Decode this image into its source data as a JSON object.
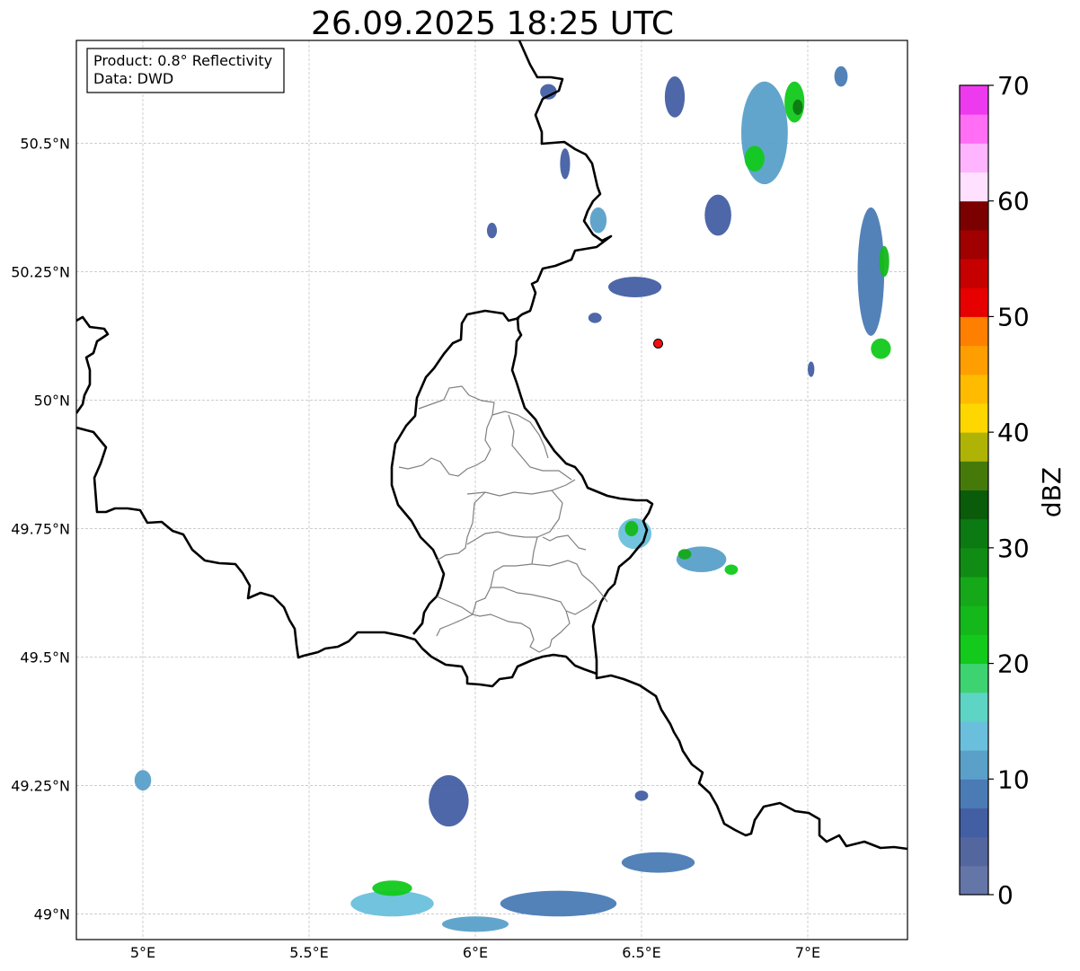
{
  "title": "26.09.2025 18:25 UTC",
  "info_box": {
    "product": "Product: 0.8° Reflectivity",
    "source": "Data: DWD"
  },
  "map": {
    "lon_range": [
      4.8,
      7.3
    ],
    "lat_range": [
      48.95,
      50.7
    ],
    "lat_ticks": [
      {
        "value": 50.5,
        "label": "50.5°N"
      },
      {
        "value": 50.25,
        "label": "50.25°N"
      },
      {
        "value": 50.0,
        "label": "50°N"
      },
      {
        "value": 49.75,
        "label": "49.75°N"
      },
      {
        "value": 49.5,
        "label": "49.5°N"
      },
      {
        "value": 49.25,
        "label": "49.25°N"
      },
      {
        "value": 49.0,
        "label": "49°N"
      }
    ],
    "lon_ticks": [
      {
        "value": 5.0,
        "label": "5°E"
      },
      {
        "value": 5.5,
        "label": "5.5°E"
      },
      {
        "value": 6.0,
        "label": "6°E"
      },
      {
        "value": 6.5,
        "label": "6.5°E"
      },
      {
        "value": 7.0,
        "label": "7°E"
      }
    ],
    "gridlines": true,
    "radar_site": {
      "lon": 6.55,
      "lat": 50.11
    },
    "echoes": [
      {
        "lon": 5.0,
        "lat": 49.26,
        "dbz": 12,
        "w": 0.05,
        "h": 0.04
      },
      {
        "lon": 5.92,
        "lat": 49.22,
        "dbz": 6,
        "w": 0.12,
        "h": 0.1
      },
      {
        "lon": 6.5,
        "lat": 49.23,
        "dbz": 5,
        "w": 0.04,
        "h": 0.02
      },
      {
        "lon": 5.75,
        "lat": 49.02,
        "dbz": 14,
        "w": 0.25,
        "h": 0.05
      },
      {
        "lon": 5.75,
        "lat": 49.05,
        "dbz": 22,
        "w": 0.12,
        "h": 0.03
      },
      {
        "lon": 6.25,
        "lat": 49.02,
        "dbz": 9,
        "w": 0.35,
        "h": 0.05
      },
      {
        "lon": 6.55,
        "lat": 49.1,
        "dbz": 8,
        "w": 0.22,
        "h": 0.04
      },
      {
        "lon": 6.0,
        "lat": 48.98,
        "dbz": 12,
        "w": 0.2,
        "h": 0.03
      },
      {
        "lon": 6.48,
        "lat": 49.74,
        "dbz": 14,
        "w": 0.1,
        "h": 0.06
      },
      {
        "lon": 6.47,
        "lat": 49.75,
        "dbz": 24,
        "w": 0.04,
        "h": 0.03
      },
      {
        "lon": 6.68,
        "lat": 49.69,
        "dbz": 12,
        "w": 0.15,
        "h": 0.05
      },
      {
        "lon": 6.63,
        "lat": 49.7,
        "dbz": 26,
        "w": 0.04,
        "h": 0.02
      },
      {
        "lon": 6.77,
        "lat": 49.67,
        "dbz": 22,
        "w": 0.04,
        "h": 0.02
      },
      {
        "lon": 6.6,
        "lat": 50.59,
        "dbz": 7,
        "w": 0.06,
        "h": 0.08
      },
      {
        "lon": 6.73,
        "lat": 50.36,
        "dbz": 6,
        "w": 0.08,
        "h": 0.08
      },
      {
        "lon": 6.87,
        "lat": 50.52,
        "dbz": 10,
        "w": 0.14,
        "h": 0.2
      },
      {
        "lon": 6.84,
        "lat": 50.47,
        "dbz": 22,
        "w": 0.06,
        "h": 0.05
      },
      {
        "lon": 6.96,
        "lat": 50.58,
        "dbz": 22,
        "w": 0.06,
        "h": 0.08
      },
      {
        "lon": 6.97,
        "lat": 50.57,
        "dbz": 32,
        "w": 0.03,
        "h": 0.03
      },
      {
        "lon": 7.19,
        "lat": 50.25,
        "dbz": 9,
        "w": 0.08,
        "h": 0.25
      },
      {
        "lon": 7.23,
        "lat": 50.27,
        "dbz": 24,
        "w": 0.03,
        "h": 0.06
      },
      {
        "lon": 7.22,
        "lat": 50.1,
        "dbz": 20,
        "w": 0.06,
        "h": 0.04
      },
      {
        "lon": 6.48,
        "lat": 50.22,
        "dbz": 7,
        "w": 0.16,
        "h": 0.04
      },
      {
        "lon": 6.37,
        "lat": 50.35,
        "dbz": 12,
        "w": 0.05,
        "h": 0.05
      },
      {
        "lon": 6.22,
        "lat": 50.6,
        "dbz": 6,
        "w": 0.05,
        "h": 0.03
      },
      {
        "lon": 6.27,
        "lat": 50.46,
        "dbz": 6,
        "w": 0.03,
        "h": 0.06
      },
      {
        "lon": 6.05,
        "lat": 50.33,
        "dbz": 7,
        "w": 0.03,
        "h": 0.03
      },
      {
        "lon": 6.36,
        "lat": 50.16,
        "dbz": 7,
        "w": 0.04,
        "h": 0.02
      },
      {
        "lon": 7.1,
        "lat": 50.63,
        "dbz": 9,
        "w": 0.04,
        "h": 0.04
      },
      {
        "lon": 7.01,
        "lat": 50.06,
        "dbz": 7,
        "w": 0.02,
        "h": 0.03
      }
    ]
  },
  "colorbar": {
    "label": "dBZ",
    "min": 0,
    "max": 70,
    "ticks": [
      "0",
      "10",
      "20",
      "30",
      "40",
      "50",
      "60",
      "70"
    ],
    "colors": [
      "#6475a8",
      "#53669e",
      "#435fa3",
      "#4a7bb5",
      "#5aa0c9",
      "#6ac0dc",
      "#5ed4c4",
      "#3ed371",
      "#12c91c",
      "#14b81a",
      "#15a818",
      "#108c14",
      "#0c7a12",
      "#0a5c0a",
      "#457a0a",
      "#afb305",
      "#ffd700",
      "#ffbb00",
      "#ff9e00",
      "#ff7f00",
      "#e60000",
      "#c60000",
      "#a00000",
      "#7b0000",
      "#ffe0ff",
      "#ffb4ff",
      "#ff6ef4",
      "#ee3aee"
    ]
  }
}
